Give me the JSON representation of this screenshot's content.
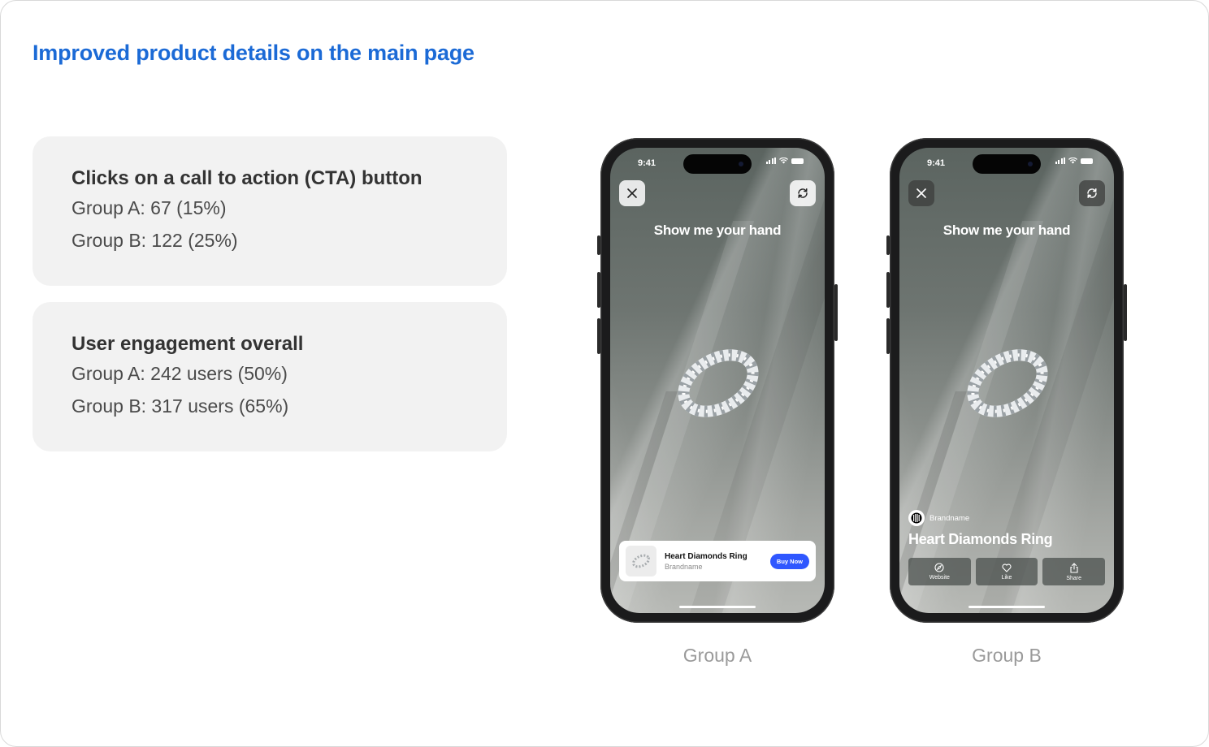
{
  "page": {
    "title": "Improved product details on the main page"
  },
  "metrics": [
    {
      "title": "Clicks on a call to action (CTA) button",
      "lines": [
        "Group A: 67 (15%)",
        "Group B: 122 (25%)"
      ]
    },
    {
      "title": "User engagement overall",
      "lines": [
        "Group A: 242 users (50%)",
        "Group B: 317 users (65%)"
      ]
    }
  ],
  "phones": {
    "status_time": "9:41",
    "prompt": "Show me your hand",
    "group_a": {
      "caption": "Group A",
      "product_name": "Heart Diamonds Ring",
      "brand": "Brandname",
      "cta_label": "Buy Now"
    },
    "group_b": {
      "caption": "Group B",
      "brand": "Brandname",
      "product_name": "Heart Diamonds Ring",
      "actions": {
        "website": "Website",
        "like": "Like",
        "share": "Share"
      }
    }
  },
  "icons": [
    "close-icon",
    "refresh-icon",
    "signal-icon",
    "wifi-icon",
    "battery-icon",
    "ring-image",
    "compass-icon",
    "heart-icon",
    "share-icon",
    "brand-logo"
  ],
  "colors": {
    "title_blue": "#1b6ad6",
    "cta_blue": "#2f57ff",
    "card_bg": "#f2f2f2",
    "caption_gray": "#9a9a9a"
  }
}
